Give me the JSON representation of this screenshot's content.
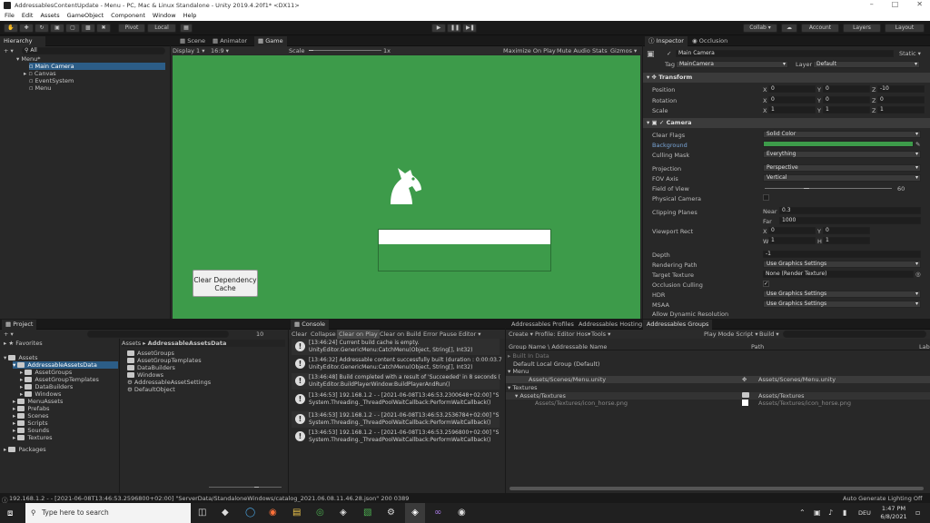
{
  "window": {
    "title": "AddressablesContentUpdate - Menu - PC, Mac & Linux Standalone - Unity 2019.4.20f1* <DX11>"
  },
  "menu": [
    "File",
    "Edit",
    "Assets",
    "GameObject",
    "Component",
    "Window",
    "Help"
  ],
  "toolbar": {
    "pivot": "Pivot",
    "local": "Local",
    "collab": "Collab ▾",
    "account": "Account",
    "layers": "Layers",
    "layout": "Layout"
  },
  "hierarchy": {
    "tab": "Hierarchy",
    "search_all": "All",
    "scene": "Menu*",
    "items": [
      "Main Camera",
      "Canvas",
      "EventSystem",
      "Menu"
    ]
  },
  "scene_tabs": [
    "Scene",
    "Animator",
    "Game"
  ],
  "game": {
    "display": "Display 1",
    "ratio": "16:9",
    "scale_label": "Scale",
    "scale_value": "1x",
    "maximize": "Maximize On Play",
    "mute": "Mute Audio",
    "stats": "Stats",
    "gizmos": "Gizmos",
    "button": "Clear Dependency Cache",
    "bg": "#3d9b4a"
  },
  "inspector": {
    "tabs": [
      "Inspector",
      "Occlusion"
    ],
    "name": "Main Camera",
    "static": "Static",
    "tag_label": "Tag",
    "tag": "MainCamera",
    "layer_label": "Layer",
    "layer": "Default",
    "transform": {
      "title": "Transform",
      "position": {
        "label": "Position",
        "x": "0",
        "y": "0",
        "z": "-10"
      },
      "rotation": {
        "label": "Rotation",
        "x": "0",
        "y": "0",
        "z": "0"
      },
      "scale": {
        "label": "Scale",
        "x": "1",
        "y": "1",
        "z": "1"
      }
    },
    "camera": {
      "title": "Camera",
      "clear_flags": {
        "label": "Clear Flags",
        "value": "Solid Color"
      },
      "background": {
        "label": "Background",
        "color": "#3d9b4a"
      },
      "culling": {
        "label": "Culling Mask",
        "value": "Everything"
      },
      "projection": {
        "label": "Projection",
        "value": "Perspective"
      },
      "fov_axis": {
        "label": "FOV Axis",
        "value": "Vertical"
      },
      "fov": {
        "label": "Field of View",
        "value": "60",
        "level": 0.33
      },
      "physical": {
        "label": "Physical Camera"
      },
      "clipping": {
        "label": "Clipping Planes",
        "near_label": "Near",
        "near": "0.3",
        "far_label": "Far",
        "far": "1000"
      },
      "viewport": {
        "label": "Viewport Rect",
        "x": "0",
        "y": "0",
        "w": "1",
        "h": "1",
        "xl": "X",
        "yl": "Y",
        "wl": "W",
        "hl": "H"
      },
      "depth": {
        "label": "Depth",
        "value": "-1"
      },
      "rendering_path": {
        "label": "Rendering Path",
        "value": "Use Graphics Settings"
      },
      "target_texture": {
        "label": "Target Texture",
        "value": "None (Render Texture)"
      },
      "occlusion": {
        "label": "Occlusion Culling"
      },
      "hdr": {
        "label": "HDR",
        "value": "Use Graphics Settings"
      },
      "msaa": {
        "label": "MSAA",
        "value": "Use Graphics Settings"
      },
      "dyn_res": {
        "label": "Allow Dynamic Resolution"
      }
    }
  },
  "project": {
    "tab": "Project",
    "favorites": "Favorites",
    "assets": "Assets",
    "tree": [
      "AddressableAssetsData",
      "AssetGroups",
      "AssetGroupTemplates",
      "DataBuilders",
      "Windows",
      "MenuAssets",
      "Prefabs",
      "Scenes",
      "Scripts",
      "Sounds",
      "Textures"
    ],
    "packages": "Packages",
    "breadcrumb_root": "Assets",
    "breadcrumb_leaf": "AddressableAssetsData",
    "count": "10",
    "files": [
      "AssetGroups",
      "AssetGroupTemplates",
      "DataBuilders",
      "Windows",
      "AddressableAssetSettings",
      "DefaultObject"
    ]
  },
  "console": {
    "tab": "Console",
    "buttons": [
      "Clear",
      "Collapse",
      "Clear on Play",
      "Clear on Build",
      "Error Pause",
      "Editor ▾"
    ],
    "entries": [
      {
        "l1": "[13:46:24] Current build cache is empty.",
        "l2": "UnityEditor.GenericMenu:CatchMenu(Object, String[], Int32)"
      },
      {
        "l1": "[13:46:32] Addressable content successfully built (duration : 0:00:03.7",
        "l2": "UnityEditor.GenericMenu:CatchMenu(Object, String[], Int32)"
      },
      {
        "l1": "[13:46:48] Build completed with a result of 'Succeeded' in 8 seconds (",
        "l2": "UnityEditor.BuildPlayerWindow:BuildPlayerAndRun()"
      },
      {
        "l1": "[13:46:53] 192.168.1.2 - - [2021-06-08T13:46:53.2300648+02:00] \"S",
        "l2": "System.Threading._ThreadPoolWaitCallback:PerformWaitCallback()"
      },
      {
        "l1": "[13:46:53] 192.168.1.2 - - [2021-06-08T13:46:53.2536784+02:00] \"S",
        "l2": "System.Threading._ThreadPoolWaitCallback:PerformWaitCallback()"
      },
      {
        "l1": "[13:46:53] 192.168.1.2 - - [2021-06-08T13:46:53.2596800+02:00] \"S",
        "l2": "System.Threading._ThreadPoolWaitCallback:PerformWaitCallback()"
      }
    ]
  },
  "addressables": {
    "tabs": [
      "Addressables Profiles",
      "Addressables Hosting",
      "Addressables Groups"
    ],
    "create": "Create ▾",
    "profile": "Profile: Editor Hos▾",
    "tools": "Tools ▾",
    "play_mode": "Play Mode Script ▾",
    "build": "Build ▾",
    "col_name": "Group Name \\ Addressable Name",
    "col_path": "Path",
    "col_labels": "Lab",
    "rows": [
      {
        "name": "Built In Data",
        "path": "",
        "ind": 0
      },
      {
        "name": "Default Local Group (Default)",
        "path": "",
        "ind": 0
      },
      {
        "name": "Menu",
        "path": "",
        "ind": 0
      },
      {
        "name": "Assets/Scenes/Menu.unity",
        "path": "Assets/Scenes/Menu.unity",
        "ind": 2
      },
      {
        "name": "Textures",
        "path": "",
        "ind": 0
      },
      {
        "name": "Assets/Textures",
        "path": "Assets/Textures",
        "ind": 1
      },
      {
        "name": "Assets/Textures/icon_horse.png",
        "path": "Assets/Textures/icon_horse.png",
        "ind": 2
      }
    ]
  },
  "status": {
    "message": "192.168.1.2 - - [2021-06-08T13:46:53.2596800+02:00] \"ServerData/StandaloneWindows/catalog_2021.06.08.11.46.28.json\" 200 0389",
    "right": "Auto Generate Lighting Off"
  },
  "taskbar": {
    "search": "Type here to search",
    "lang": "DEU",
    "time": "1:47 PM",
    "date": "6/8/2021"
  }
}
